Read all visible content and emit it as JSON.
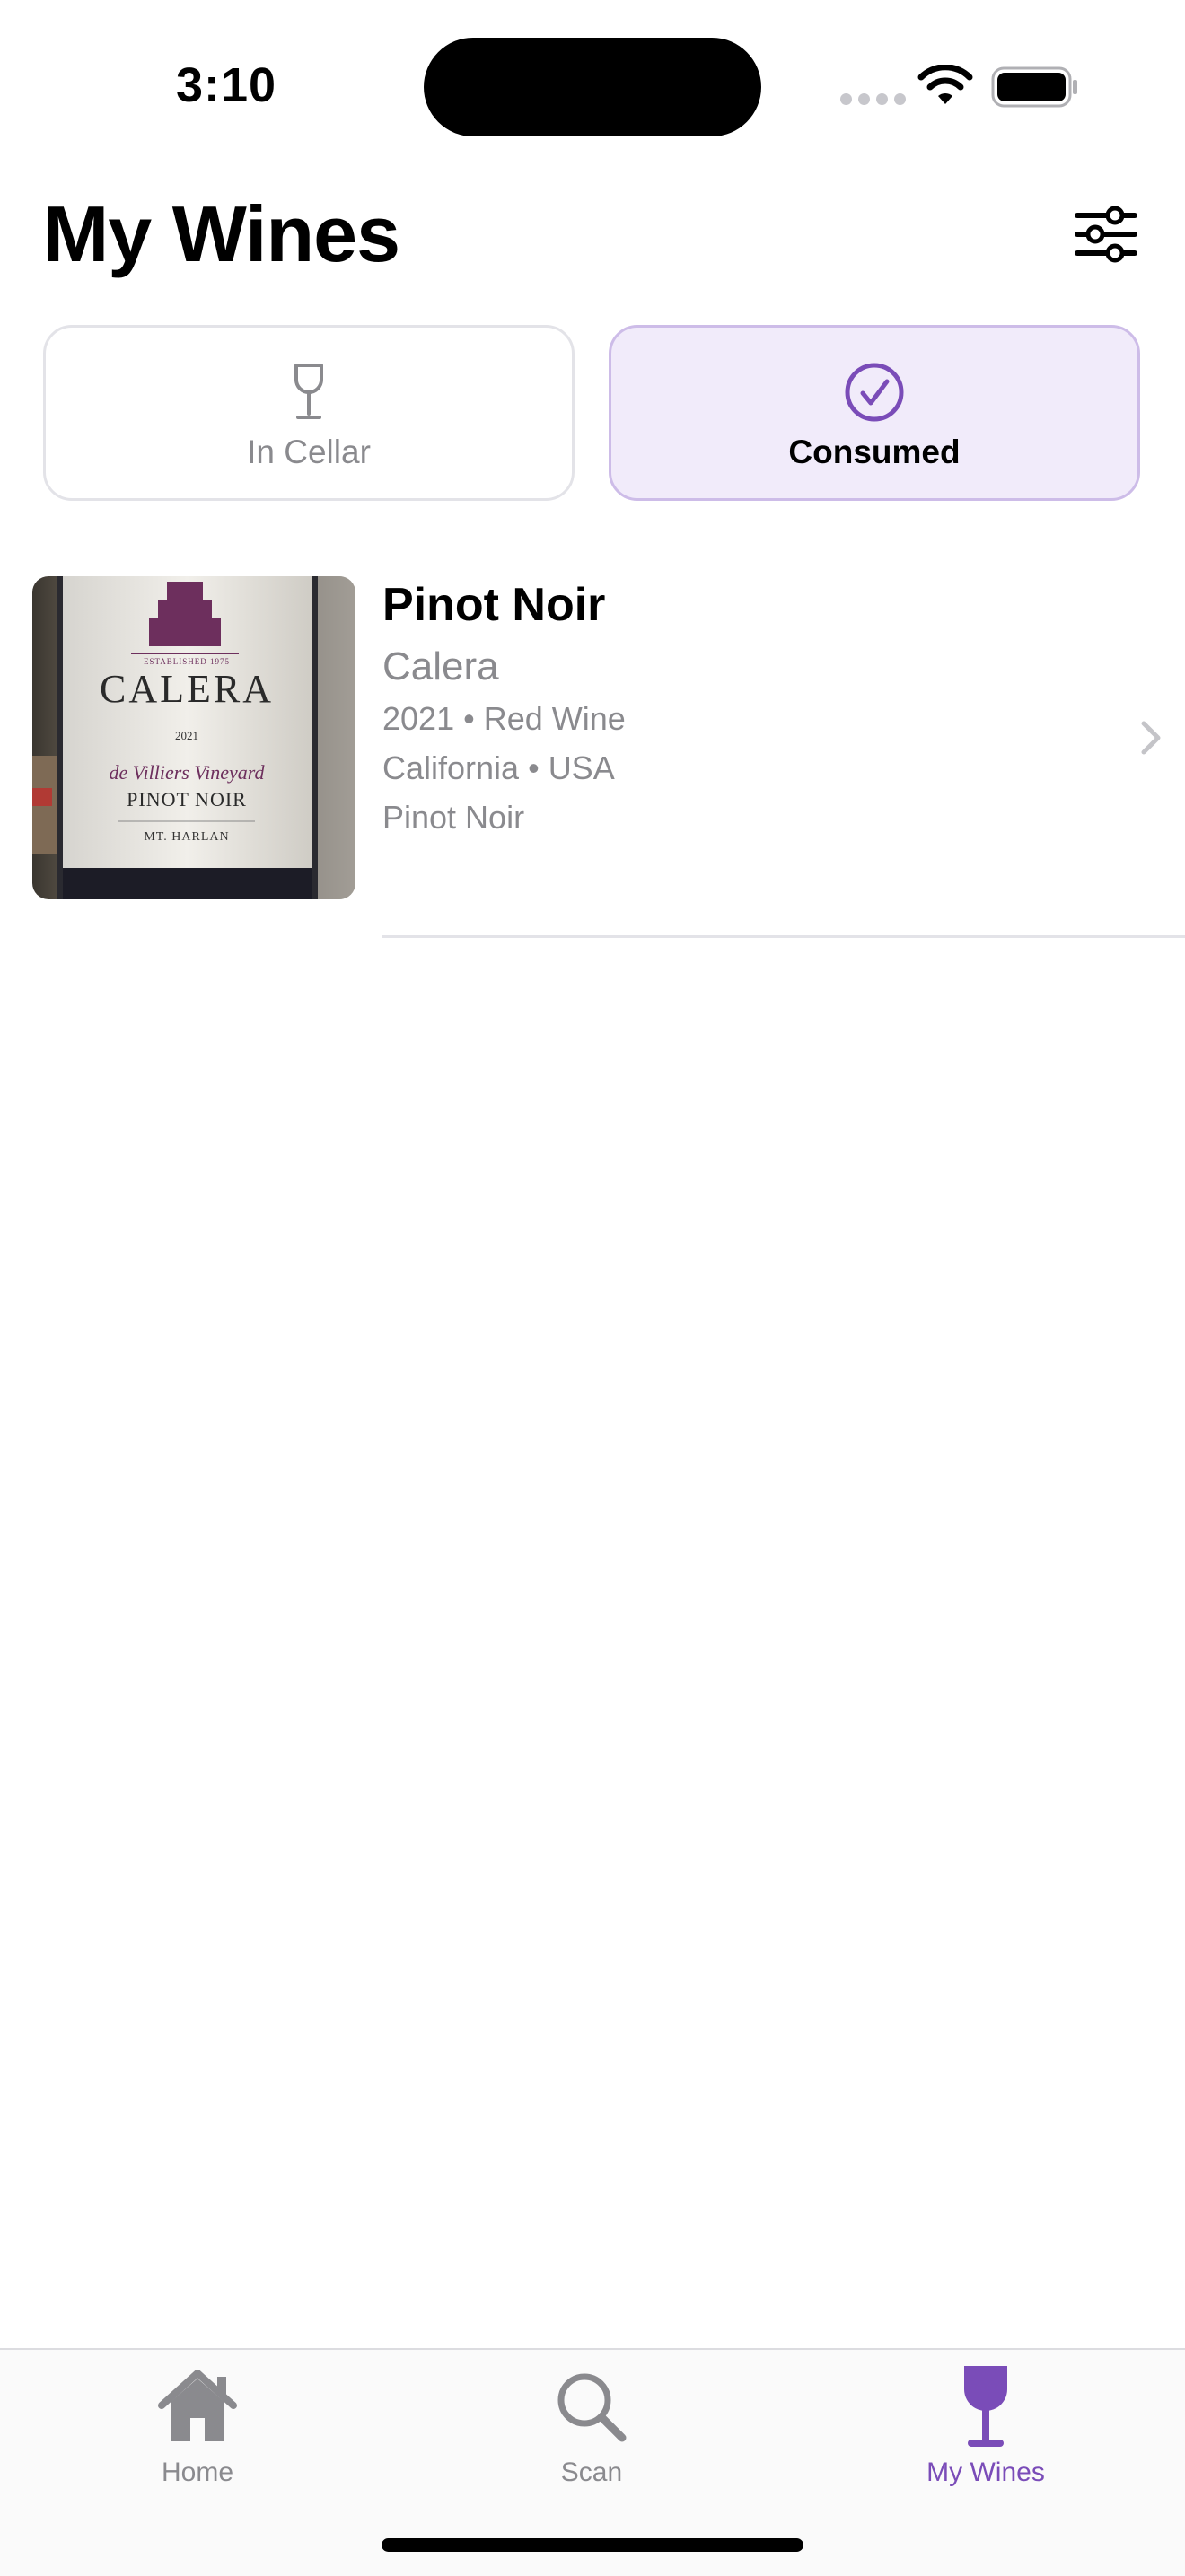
{
  "status_bar": {
    "time": "3:10"
  },
  "header": {
    "title": "My Wines",
    "filter_icon": "sliders-icon"
  },
  "segments": [
    {
      "label": "In Cellar",
      "icon": "wine-glass-icon",
      "selected": false
    },
    {
      "label": "Consumed",
      "icon": "checkmark-circle-icon",
      "selected": true
    }
  ],
  "wines": [
    {
      "name": "Pinot Noir",
      "producer": "Calera",
      "vintage": "2021",
      "type": "Red Wine",
      "region": "California",
      "country": "USA",
      "varietal": "Pinot Noir",
      "label": {
        "established": "ESTABLISHED 1975",
        "brand": "CALERA",
        "year": "2021",
        "vineyard": "de Villiers Vineyard",
        "wine": "PINOT NOIR",
        "appellation": "MT. HARLAN"
      }
    }
  ],
  "tab_bar": {
    "tabs": [
      {
        "label": "Home",
        "icon": "house-icon",
        "selected": false
      },
      {
        "label": "Scan",
        "icon": "magnifying-glass-icon",
        "selected": false
      },
      {
        "label": "My Wines",
        "icon": "wine-glass-filled-icon",
        "selected": true
      }
    ]
  },
  "colors": {
    "accent": "#7a4cb8",
    "selected_segment_bg": "#f1ebfa",
    "secondary_text": "#8a8a8e"
  }
}
